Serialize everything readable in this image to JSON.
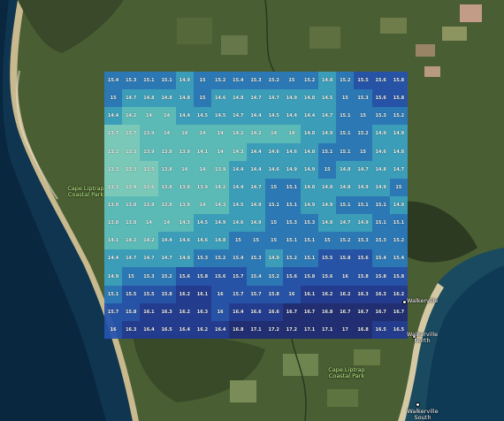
{
  "places": {
    "cape_liptrap_west_1": "Cape Liptrap",
    "cape_liptrap_west_2": "Coastal Park",
    "cape_liptrap_south_1": "Cape Liptrap",
    "cape_liptrap_south_2": "Coastal Park",
    "walkerville": "Walkerville",
    "walkerville_north_1": "Walkerville",
    "walkerville_north_2": "North",
    "walkerville_south_1": "Walkerville",
    "walkerville_south_2": "South"
  },
  "grid": {
    "columns": 20,
    "color_scale": [
      "#7fd3c4",
      "#5ec2c2",
      "#3aa3c4",
      "#2a7bc0",
      "#2553b0",
      "#213a96",
      "#1e2a78"
    ],
    "values": [
      [
        15.4,
        15.3,
        15.1,
        15.1,
        14.9,
        15,
        15.2,
        15.4,
        15.3,
        15.2,
        15,
        15.2,
        14.8,
        15.2,
        15.5,
        15.6,
        15.8
      ],
      [
        15,
        14.7,
        14.8,
        14.8,
        14.8,
        15,
        14.6,
        14.8,
        14.7,
        14.7,
        14.9,
        14.8,
        14.5,
        15,
        15.3,
        15.6,
        15.8
      ],
      [
        14.4,
        14.2,
        14,
        14,
        14.4,
        14.5,
        14.5,
        14.7,
        14.4,
        14.5,
        14.4,
        14.4,
        14.7,
        15.1,
        15,
        15.3,
        15.2
      ],
      [
        13.7,
        13.7,
        13.9,
        14,
        14,
        14,
        14,
        14.2,
        14.2,
        14,
        14,
        14.8,
        14.9,
        15.1,
        15.2,
        14.9,
        14.9
      ],
      [
        13.2,
        13.3,
        13.9,
        13.8,
        13.9,
        14.1,
        14,
        14.3,
        14.4,
        14.6,
        14.6,
        14.8,
        15.1,
        15.1,
        15,
        14.6,
        14.8
      ],
      [
        13.3,
        13.3,
        13.5,
        13.8,
        14,
        14,
        13.9,
        14.4,
        14.4,
        14.6,
        14.9,
        14.9,
        15,
        14.8,
        14.7,
        14.8,
        14.7
      ],
      [
        13.3,
        13.4,
        13.6,
        13.8,
        13.8,
        13.9,
        14.2,
        14.4,
        14.7,
        15,
        15.1,
        14.8,
        14.8,
        14.8,
        14.9,
        14.9,
        15
      ],
      [
        13.8,
        13.8,
        13.8,
        13.8,
        13.8,
        14,
        14.3,
        14.5,
        14.9,
        15.1,
        15.1,
        14.9,
        14.9,
        15.1,
        15.1,
        15.1,
        14.9
      ],
      [
        13.8,
        13.8,
        14,
        14,
        14.3,
        14.5,
        14.9,
        14.6,
        14.9,
        15,
        15.3,
        15.3,
        14.8,
        14.7,
        14.9,
        15.1,
        15.1
      ],
      [
        14.1,
        14.2,
        14.2,
        14.4,
        14.6,
        14.6,
        14.8,
        15,
        15,
        15,
        15.1,
        15.1,
        15,
        15.2,
        15.3,
        15.3,
        15.2
      ],
      [
        14.4,
        14.7,
        14.7,
        14.7,
        14.9,
        15.3,
        15.2,
        15.4,
        15.3,
        14.9,
        15.2,
        15.1,
        15.5,
        15.8,
        15.6,
        15.4,
        15.4
      ],
      [
        14.9,
        15,
        15.3,
        15.2,
        15.6,
        15.8,
        15.6,
        15.7,
        15.4,
        15.2,
        15.6,
        15.8,
        15.6,
        16,
        15.8,
        15.8,
        15.8
      ],
      [
        15.1,
        15.5,
        15.5,
        15.8,
        16.2,
        16.1,
        16,
        15.7,
        15.7,
        15.8,
        16,
        16.1,
        16.2,
        16.2,
        16.3,
        16.3,
        16.2
      ],
      [
        15.7,
        15.8,
        16.1,
        16.3,
        16.2,
        16.3,
        16,
        16.4,
        16.6,
        16.6,
        16.7,
        16.7,
        16.8,
        16.7,
        16.7,
        16.7,
        16.7
      ],
      [
        16,
        16.3,
        16.4,
        16.5,
        16.4,
        16.2,
        16.4,
        16.8,
        17.1,
        17.2,
        17.2,
        17.1,
        17.1,
        17,
        16.8,
        16.5,
        16.5
      ]
    ]
  }
}
